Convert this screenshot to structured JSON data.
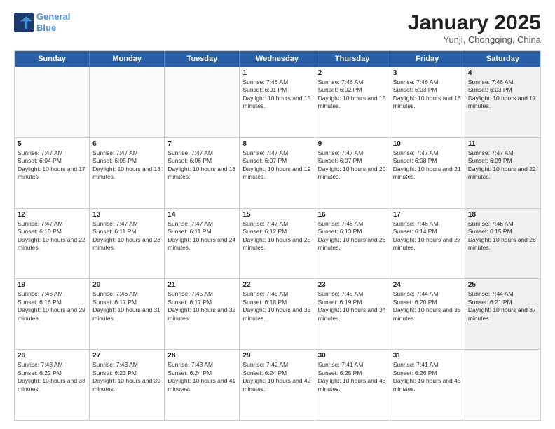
{
  "header": {
    "logo_line1": "General",
    "logo_line2": "Blue",
    "title": "January 2025",
    "subtitle": "Yunji, Chongqing, China"
  },
  "days_of_week": [
    "Sunday",
    "Monday",
    "Tuesday",
    "Wednesday",
    "Thursday",
    "Friday",
    "Saturday"
  ],
  "weeks": [
    [
      {
        "day": "",
        "sunrise": "",
        "sunset": "",
        "daylight": "",
        "shaded": false,
        "empty": true
      },
      {
        "day": "",
        "sunrise": "",
        "sunset": "",
        "daylight": "",
        "shaded": false,
        "empty": true
      },
      {
        "day": "",
        "sunrise": "",
        "sunset": "",
        "daylight": "",
        "shaded": false,
        "empty": true
      },
      {
        "day": "1",
        "sunrise": "Sunrise: 7:46 AM",
        "sunset": "Sunset: 6:01 PM",
        "daylight": "Daylight: 10 hours and 15 minutes.",
        "shaded": false,
        "empty": false
      },
      {
        "day": "2",
        "sunrise": "Sunrise: 7:46 AM",
        "sunset": "Sunset: 6:02 PM",
        "daylight": "Daylight: 10 hours and 15 minutes.",
        "shaded": false,
        "empty": false
      },
      {
        "day": "3",
        "sunrise": "Sunrise: 7:46 AM",
        "sunset": "Sunset: 6:03 PM",
        "daylight": "Daylight: 10 hours and 16 minutes.",
        "shaded": false,
        "empty": false
      },
      {
        "day": "4",
        "sunrise": "Sunrise: 7:46 AM",
        "sunset": "Sunset: 6:03 PM",
        "daylight": "Daylight: 10 hours and 17 minutes.",
        "shaded": true,
        "empty": false
      }
    ],
    [
      {
        "day": "5",
        "sunrise": "Sunrise: 7:47 AM",
        "sunset": "Sunset: 6:04 PM",
        "daylight": "Daylight: 10 hours and 17 minutes.",
        "shaded": false,
        "empty": false
      },
      {
        "day": "6",
        "sunrise": "Sunrise: 7:47 AM",
        "sunset": "Sunset: 6:05 PM",
        "daylight": "Daylight: 10 hours and 18 minutes.",
        "shaded": false,
        "empty": false
      },
      {
        "day": "7",
        "sunrise": "Sunrise: 7:47 AM",
        "sunset": "Sunset: 6:06 PM",
        "daylight": "Daylight: 10 hours and 18 minutes.",
        "shaded": false,
        "empty": false
      },
      {
        "day": "8",
        "sunrise": "Sunrise: 7:47 AM",
        "sunset": "Sunset: 6:07 PM",
        "daylight": "Daylight: 10 hours and 19 minutes.",
        "shaded": false,
        "empty": false
      },
      {
        "day": "9",
        "sunrise": "Sunrise: 7:47 AM",
        "sunset": "Sunset: 6:07 PM",
        "daylight": "Daylight: 10 hours and 20 minutes.",
        "shaded": false,
        "empty": false
      },
      {
        "day": "10",
        "sunrise": "Sunrise: 7:47 AM",
        "sunset": "Sunset: 6:08 PM",
        "daylight": "Daylight: 10 hours and 21 minutes.",
        "shaded": false,
        "empty": false
      },
      {
        "day": "11",
        "sunrise": "Sunrise: 7:47 AM",
        "sunset": "Sunset: 6:09 PM",
        "daylight": "Daylight: 10 hours and 22 minutes.",
        "shaded": true,
        "empty": false
      }
    ],
    [
      {
        "day": "12",
        "sunrise": "Sunrise: 7:47 AM",
        "sunset": "Sunset: 6:10 PM",
        "daylight": "Daylight: 10 hours and 22 minutes.",
        "shaded": false,
        "empty": false
      },
      {
        "day": "13",
        "sunrise": "Sunrise: 7:47 AM",
        "sunset": "Sunset: 6:11 PM",
        "daylight": "Daylight: 10 hours and 23 minutes.",
        "shaded": false,
        "empty": false
      },
      {
        "day": "14",
        "sunrise": "Sunrise: 7:47 AM",
        "sunset": "Sunset: 6:11 PM",
        "daylight": "Daylight: 10 hours and 24 minutes.",
        "shaded": false,
        "empty": false
      },
      {
        "day": "15",
        "sunrise": "Sunrise: 7:47 AM",
        "sunset": "Sunset: 6:12 PM",
        "daylight": "Daylight: 10 hours and 25 minutes.",
        "shaded": false,
        "empty": false
      },
      {
        "day": "16",
        "sunrise": "Sunrise: 7:46 AM",
        "sunset": "Sunset: 6:13 PM",
        "daylight": "Daylight: 10 hours and 26 minutes.",
        "shaded": false,
        "empty": false
      },
      {
        "day": "17",
        "sunrise": "Sunrise: 7:46 AM",
        "sunset": "Sunset: 6:14 PM",
        "daylight": "Daylight: 10 hours and 27 minutes.",
        "shaded": false,
        "empty": false
      },
      {
        "day": "18",
        "sunrise": "Sunrise: 7:46 AM",
        "sunset": "Sunset: 6:15 PM",
        "daylight": "Daylight: 10 hours and 28 minutes.",
        "shaded": true,
        "empty": false
      }
    ],
    [
      {
        "day": "19",
        "sunrise": "Sunrise: 7:46 AM",
        "sunset": "Sunset: 6:16 PM",
        "daylight": "Daylight: 10 hours and 29 minutes.",
        "shaded": false,
        "empty": false
      },
      {
        "day": "20",
        "sunrise": "Sunrise: 7:46 AM",
        "sunset": "Sunset: 6:17 PM",
        "daylight": "Daylight: 10 hours and 31 minutes.",
        "shaded": false,
        "empty": false
      },
      {
        "day": "21",
        "sunrise": "Sunrise: 7:45 AM",
        "sunset": "Sunset: 6:17 PM",
        "daylight": "Daylight: 10 hours and 32 minutes.",
        "shaded": false,
        "empty": false
      },
      {
        "day": "22",
        "sunrise": "Sunrise: 7:45 AM",
        "sunset": "Sunset: 6:18 PM",
        "daylight": "Daylight: 10 hours and 33 minutes.",
        "shaded": false,
        "empty": false
      },
      {
        "day": "23",
        "sunrise": "Sunrise: 7:45 AM",
        "sunset": "Sunset: 6:19 PM",
        "daylight": "Daylight: 10 hours and 34 minutes.",
        "shaded": false,
        "empty": false
      },
      {
        "day": "24",
        "sunrise": "Sunrise: 7:44 AM",
        "sunset": "Sunset: 6:20 PM",
        "daylight": "Daylight: 10 hours and 35 minutes.",
        "shaded": false,
        "empty": false
      },
      {
        "day": "25",
        "sunrise": "Sunrise: 7:44 AM",
        "sunset": "Sunset: 6:21 PM",
        "daylight": "Daylight: 10 hours and 37 minutes.",
        "shaded": true,
        "empty": false
      }
    ],
    [
      {
        "day": "26",
        "sunrise": "Sunrise: 7:43 AM",
        "sunset": "Sunset: 6:22 PM",
        "daylight": "Daylight: 10 hours and 38 minutes.",
        "shaded": false,
        "empty": false
      },
      {
        "day": "27",
        "sunrise": "Sunrise: 7:43 AM",
        "sunset": "Sunset: 6:23 PM",
        "daylight": "Daylight: 10 hours and 39 minutes.",
        "shaded": false,
        "empty": false
      },
      {
        "day": "28",
        "sunrise": "Sunrise: 7:43 AM",
        "sunset": "Sunset: 6:24 PM",
        "daylight": "Daylight: 10 hours and 41 minutes.",
        "shaded": false,
        "empty": false
      },
      {
        "day": "29",
        "sunrise": "Sunrise: 7:42 AM",
        "sunset": "Sunset: 6:24 PM",
        "daylight": "Daylight: 10 hours and 42 minutes.",
        "shaded": false,
        "empty": false
      },
      {
        "day": "30",
        "sunrise": "Sunrise: 7:41 AM",
        "sunset": "Sunset: 6:25 PM",
        "daylight": "Daylight: 10 hours and 43 minutes.",
        "shaded": false,
        "empty": false
      },
      {
        "day": "31",
        "sunrise": "Sunrise: 7:41 AM",
        "sunset": "Sunset: 6:26 PM",
        "daylight": "Daylight: 10 hours and 45 minutes.",
        "shaded": false,
        "empty": false
      },
      {
        "day": "",
        "sunrise": "",
        "sunset": "",
        "daylight": "",
        "shaded": true,
        "empty": true
      }
    ]
  ]
}
